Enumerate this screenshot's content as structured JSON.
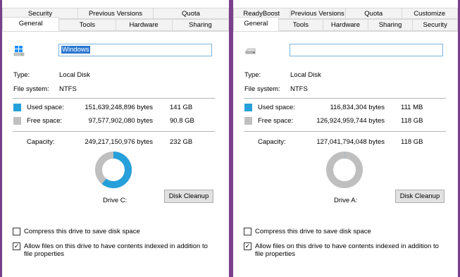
{
  "left": {
    "tabs_top": [
      "Security",
      "Previous Versions",
      "Quota"
    ],
    "tabs_bottom": [
      "General",
      "Tools",
      "Hardware",
      "Sharing"
    ],
    "drive_name": "Windows",
    "type_label": "Type:",
    "type_value": "Local Disk",
    "fs_label": "File system:",
    "fs_value": "NTFS",
    "used_label": "Used space:",
    "used_bytes": "151,639,248,896 bytes",
    "used_size": "141 GB",
    "free_label": "Free space:",
    "free_bytes": "97,577,902,080 bytes",
    "free_size": "90.8 GB",
    "cap_label": "Capacity:",
    "cap_bytes": "249,217,150,976 bytes",
    "cap_size": "232 GB",
    "drive_label": "Drive C:",
    "cleanup": "Disk Cleanup",
    "compress": "Compress this drive to save disk space",
    "index_line1": "Allow files on this drive to have contents indexed in addition to",
    "index_line2": "file properties",
    "used_fraction": 0.608,
    "compress_checked": false,
    "index_checked": true
  },
  "right": {
    "tabs_top": [
      "ReadyBoost",
      "Previous Versions",
      "Quota",
      "Customize"
    ],
    "tabs_bottom": [
      "General",
      "Tools",
      "Hardware",
      "Sharing",
      "Security"
    ],
    "drive_name": "",
    "type_label": "Type:",
    "type_value": "Local Disk",
    "fs_label": "File system:",
    "fs_value": "NTFS",
    "used_label": "Used space:",
    "used_bytes": "116,834,304 bytes",
    "used_size": "111 MB",
    "free_label": "Free space:",
    "free_bytes": "126,924,959,744 bytes",
    "free_size": "118 GB",
    "cap_label": "Capacity:",
    "cap_bytes": "127,041,794,048 bytes",
    "cap_size": "118 GB",
    "drive_label": "Drive A:",
    "cleanup": "Disk Cleanup",
    "compress": "Compress this drive to save disk space",
    "index_line1": "Allow files on this drive to have contents indexed in addition to",
    "index_line2": "file properties",
    "used_fraction": 0.001,
    "compress_checked": false,
    "index_checked": true
  },
  "colors": {
    "used": "#26a0da",
    "free": "#bfbfbf",
    "frame": "#7a3f8a"
  },
  "icons": {
    "left_drive": "windows-drive-icon",
    "right_drive": "removable-drive-icon"
  }
}
